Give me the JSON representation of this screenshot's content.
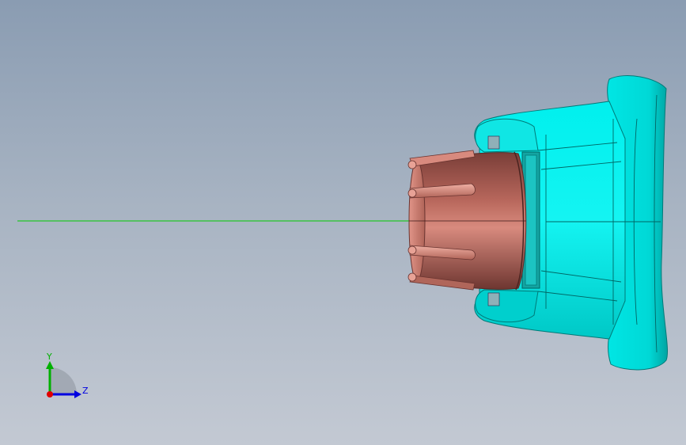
{
  "viewport": {
    "background_top": "#8a9cb2",
    "background_bottom": "#c3c9d3"
  },
  "colors": {
    "housing": "#00e8e6",
    "housing_dark": "#00a8a6",
    "connector": "#c97a6e",
    "connector_dark": "#8a4a42",
    "axis_line": "#00cc00"
  },
  "triad": {
    "y_label": "Y",
    "z_label": "Z",
    "y_color": "#00b000",
    "z_color": "#0000e0",
    "x_color": "#e00000"
  }
}
